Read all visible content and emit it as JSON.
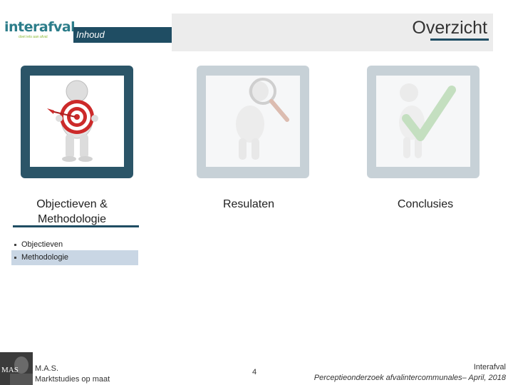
{
  "header": {
    "logo_text": "interafval",
    "logo_dot": ".",
    "logo_tagline": "doet iets aan afval",
    "section_label": "Inhoud",
    "title": "Overzicht"
  },
  "cards": [
    {
      "label": "Objectieven & Methodologie",
      "state": "active"
    },
    {
      "label": "Resulaten",
      "state": "inactive"
    },
    {
      "label": "Conclusies",
      "state": "inactive"
    }
  ],
  "subitems": [
    {
      "label": "Objectieven",
      "selected": false
    },
    {
      "label": "Methodologie",
      "selected": true
    }
  ],
  "footer": {
    "logo_text": "MAS",
    "company_line1": "M.A.S.",
    "company_line2": "Marktstudies op maat",
    "page_number": "4",
    "right_line1": "Interafval",
    "right_line2": "Perceptieonderzoek afvalintercommunales– April, 2018"
  },
  "colors": {
    "primary": "#1f4d63",
    "accent": "#2c7d8a",
    "green": "#8dbb3a",
    "selected_bg": "#c9d6e4",
    "target_red": "#cc2a2a"
  }
}
